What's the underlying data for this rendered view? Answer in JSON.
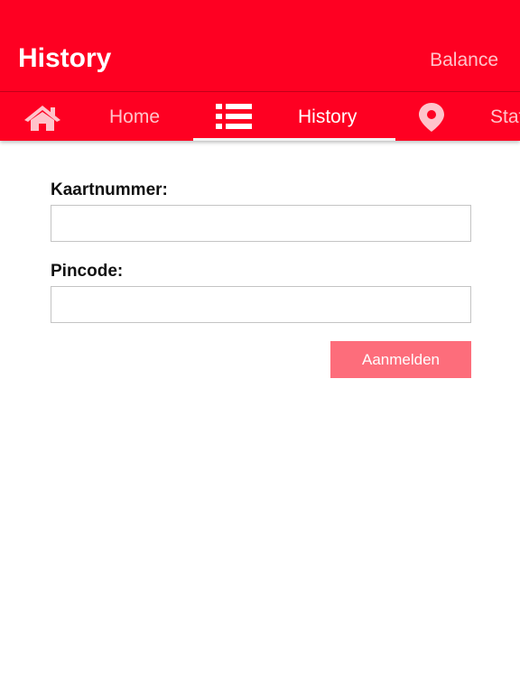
{
  "appbar": {
    "title": "History",
    "action_label": "Balance"
  },
  "tabs": [
    {
      "label": "Home",
      "icon": "home-icon",
      "active": false
    },
    {
      "label": "History",
      "icon": "list-icon",
      "active": true
    },
    {
      "label": "Stations",
      "icon": "location-pin-icon",
      "active": false
    }
  ],
  "form": {
    "card_label": "Kaartnummer:",
    "card_value": "",
    "pin_label": "Pincode:",
    "pin_value": "",
    "submit_label": "Aanmelden"
  },
  "colors": {
    "primary": "#fe0022",
    "tab_inactive_text": "#ffc3cb",
    "button": "#fd6d7b"
  }
}
